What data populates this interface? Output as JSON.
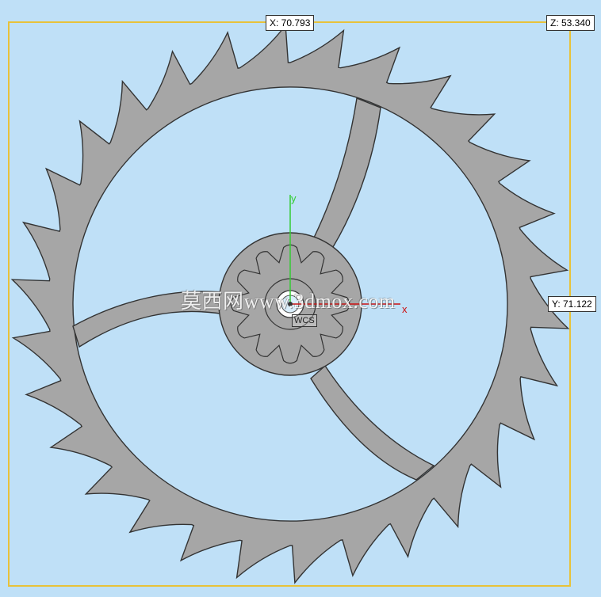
{
  "dimensions": {
    "x_label": "X: 70.793",
    "y_label": "Y: 71.122",
    "z_label": "Z: 53.340"
  },
  "triad": {
    "x_axis": "x",
    "y_axis": "y",
    "wcs_label": "WCS"
  },
  "watermark": "莫西网www.3dmox.com",
  "model": {
    "name": "escape-wheel",
    "outer_teeth": 30,
    "pinion_teeth": 12,
    "spokes": 3
  },
  "colors": {
    "background": "#bfe0f7",
    "part_fill": "#a6a6a6",
    "edge": "#333333",
    "bounding_box": "#e8c23a",
    "x_axis": "#cc1111",
    "y_axis": "#33cc33"
  }
}
